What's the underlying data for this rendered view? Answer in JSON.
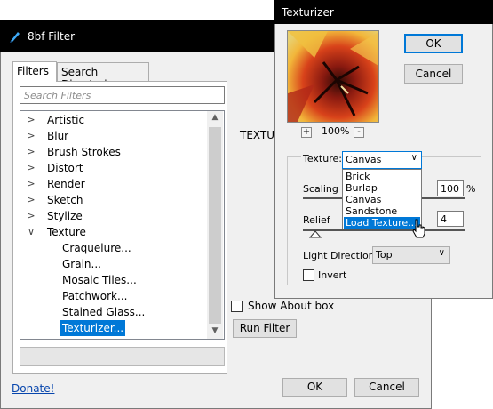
{
  "main": {
    "title": "8bf Filter",
    "tabs": [
      "Filters",
      "Search Directories"
    ],
    "search_placeholder": "Search Filters",
    "tree": [
      {
        "label": "Artistic",
        "arrow": ">"
      },
      {
        "label": "Blur",
        "arrow": ">"
      },
      {
        "label": "Brush Strokes",
        "arrow": ">"
      },
      {
        "label": "Distort",
        "arrow": ">"
      },
      {
        "label": "Render",
        "arrow": ">"
      },
      {
        "label": "Sketch",
        "arrow": ">"
      },
      {
        "label": "Stylize",
        "arrow": ">"
      },
      {
        "label": "Texture",
        "arrow": "v"
      }
    ],
    "children": [
      "Craquelure...",
      "Grain...",
      "Mosaic Tiles...",
      "Patchwork...",
      "Stained Glass...",
      "Texturizer..."
    ],
    "selected_child": "Texturizer...",
    "filter_label": "TEXTUR",
    "show_about_label": "Show About box",
    "show_about_checked": false,
    "run_filter": "Run Filter",
    "donate": "Donate!",
    "ok": "OK",
    "cancel": "Cancel"
  },
  "texturizer": {
    "title": "Texturizer",
    "ok": "OK",
    "cancel": "Cancel",
    "zoom": "100%",
    "zoom_in": "+",
    "zoom_out": "-",
    "texture_label": "Texture:",
    "texture_value": "Canvas",
    "options": [
      "Brick",
      "Burlap",
      "Canvas",
      "Sandstone",
      "Load Texture..."
    ],
    "highlighted_option": "Load Texture...",
    "scaling_label": "Scaling",
    "scaling_value": "100",
    "scaling_unit": "%",
    "relief_label": "Relief",
    "relief_value": "4",
    "light_label": "Light Direction:",
    "light_value": "Top",
    "invert_label": "Invert",
    "invert_checked": false
  },
  "colors": {
    "accent": "#0078d7",
    "title_bar": "#000000"
  }
}
